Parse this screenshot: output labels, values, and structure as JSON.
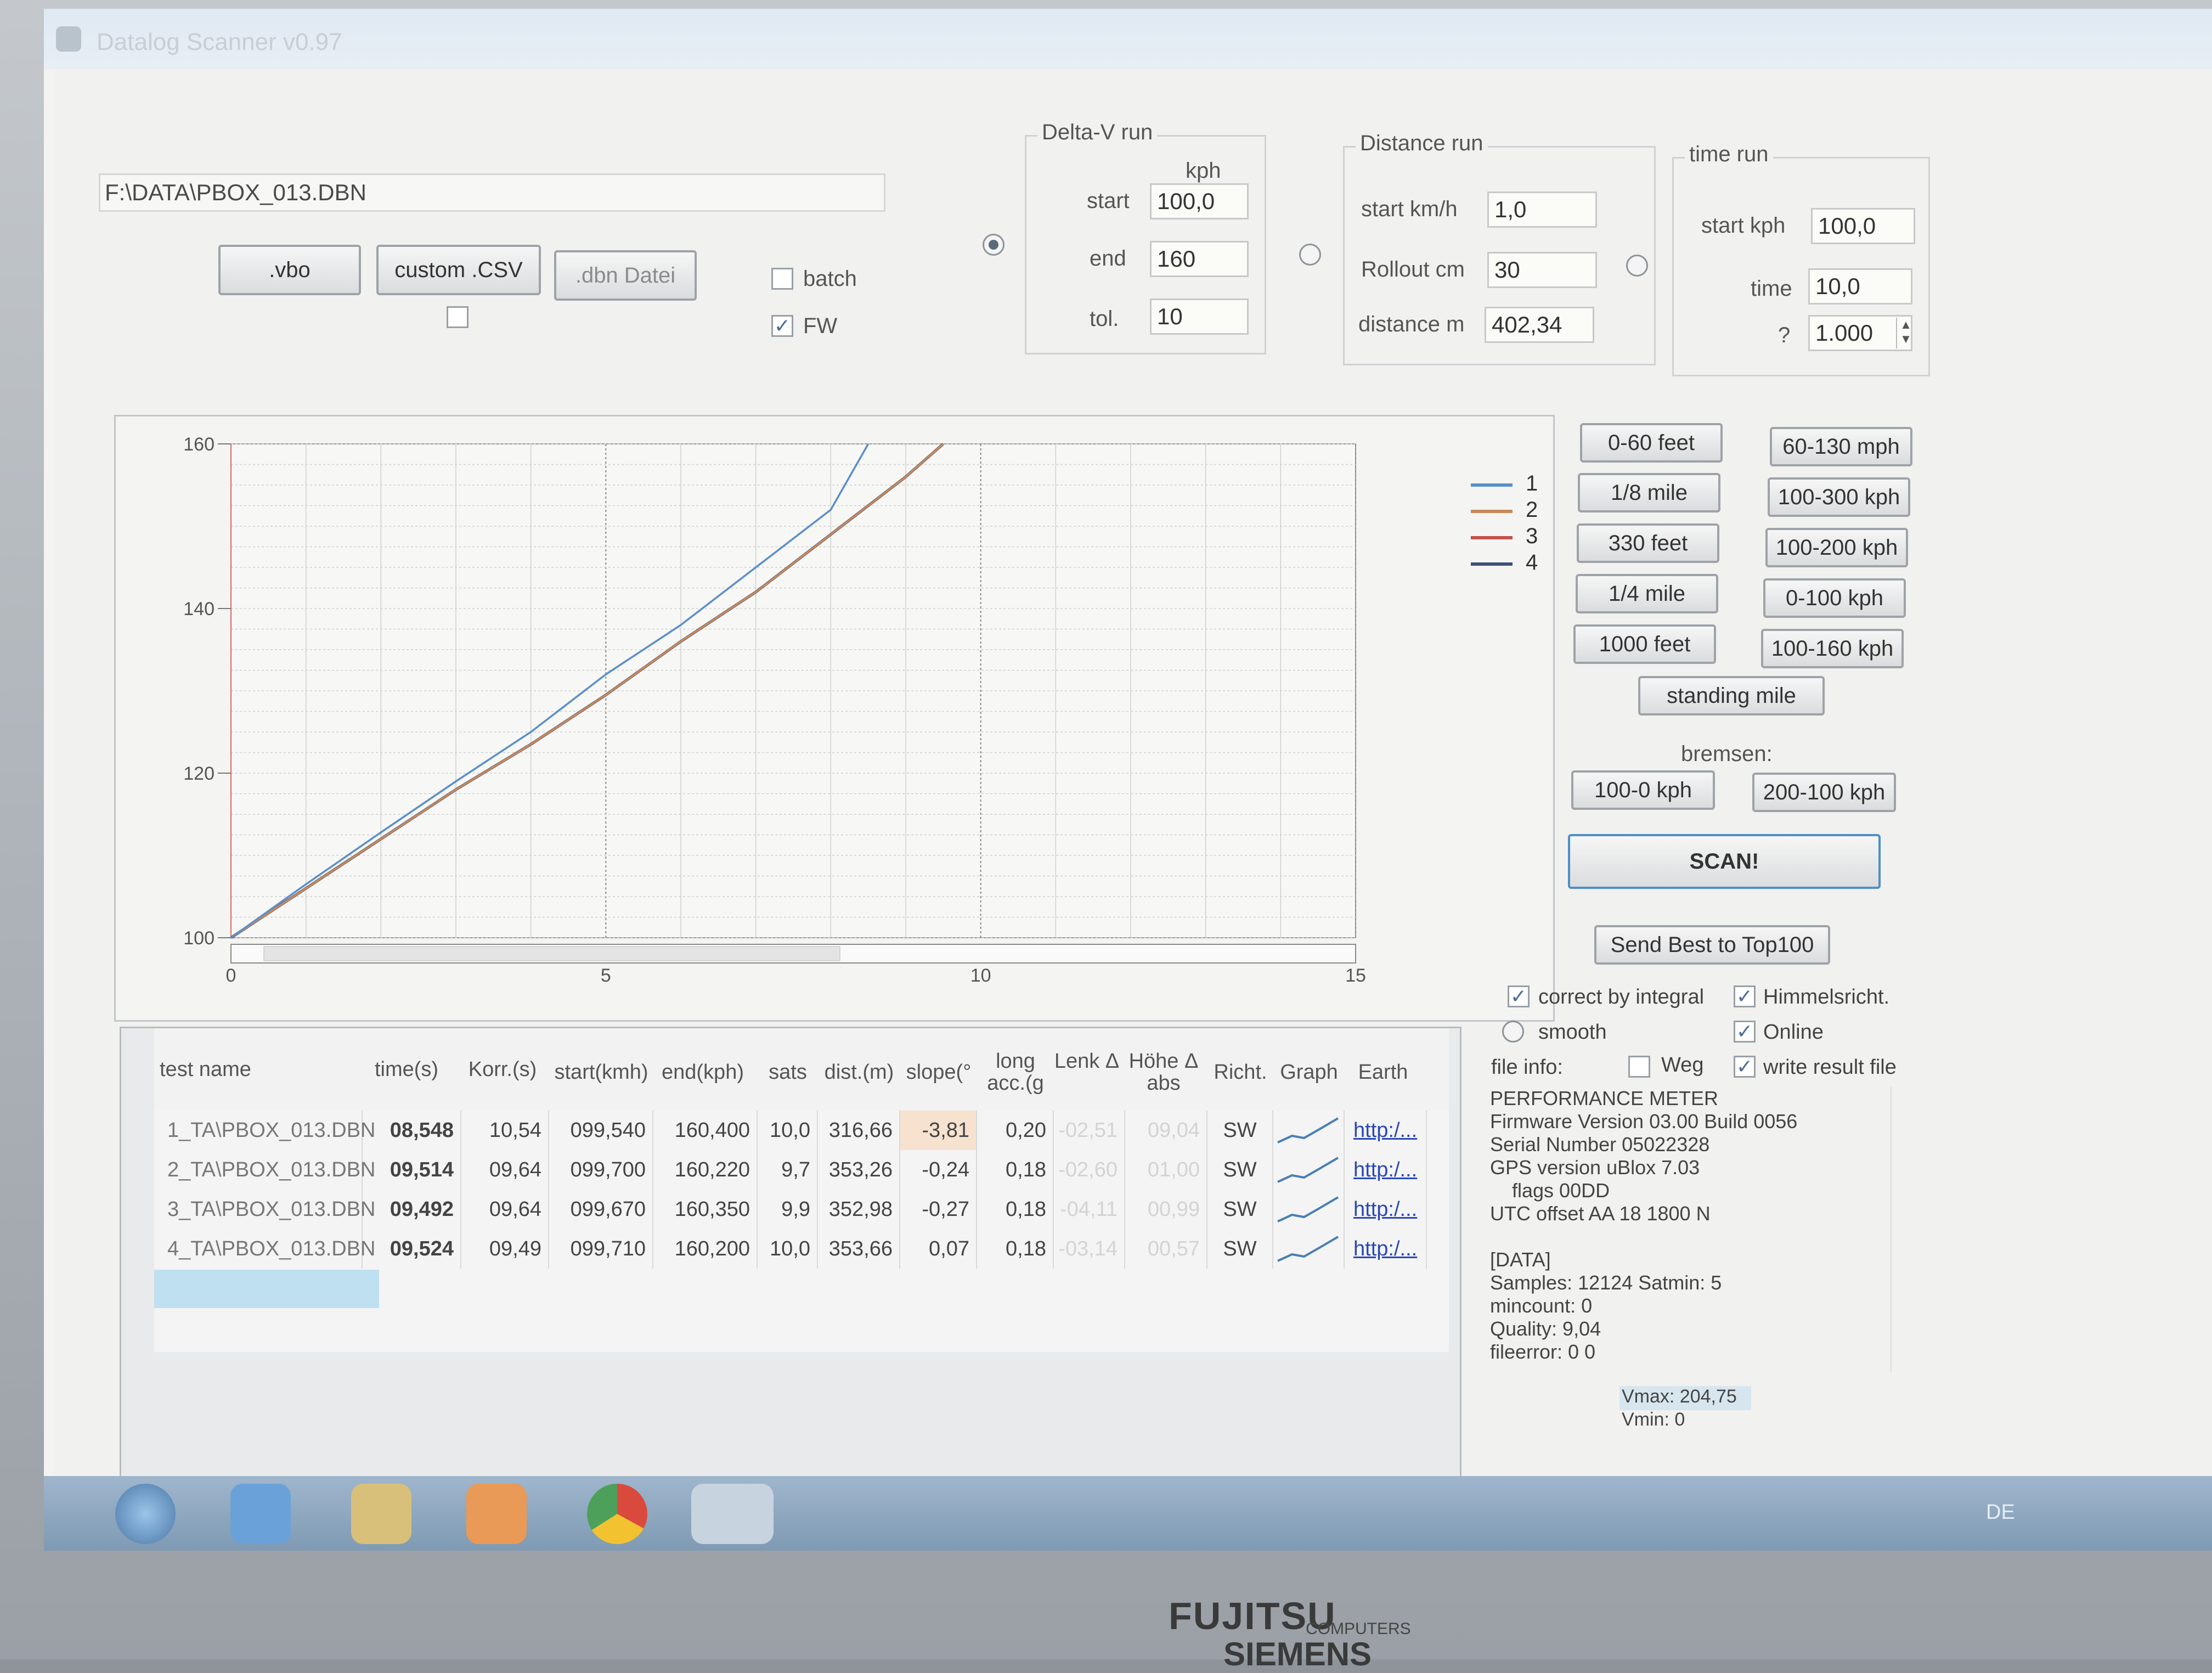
{
  "window": {
    "title": "Datalog Scanner v0.97"
  },
  "file": {
    "path": "F:\\DATA\\PBOX_013.DBN"
  },
  "buttons": {
    "vbo": ".vbo",
    "csv": "custom .CSV",
    "dbn": ".dbn Datei"
  },
  "options": {
    "batch": "batch",
    "fw": "FW"
  },
  "delta_v": {
    "title": "Delta-V run",
    "unit": "kph",
    "start_label": "start",
    "start": "100,0",
    "end_label": "end",
    "end": "160",
    "tol_label": "tol.",
    "tol": "10"
  },
  "distance_run": {
    "title": "Distance run",
    "start_label": "start km/h",
    "start": "1,0",
    "rollout_label": "Rollout cm",
    "rollout": "30",
    "distance_label": "distance m",
    "distance": "402,34"
  },
  "time_run": {
    "title": "time run",
    "start_label": "start kph",
    "start": "100,0",
    "time_label": "time",
    "time": "10,0",
    "q_label": "?",
    "q_value": "1.000"
  },
  "chart_data": {
    "type": "line",
    "title": "",
    "xlabel": "",
    "ylabel": "",
    "xlim": [
      0,
      15
    ],
    "ylim": [
      100,
      160
    ],
    "x_ticks": [
      "0",
      "5",
      "10",
      "15"
    ],
    "y_ticks": [
      "100",
      "120",
      "140",
      "160"
    ],
    "legend": [
      "1",
      "2",
      "3",
      "4"
    ],
    "legend_position": "top-right",
    "grid": true,
    "colors": [
      "#5b8fc9",
      "#c98a58",
      "#c4504a",
      "#3e4f7a"
    ],
    "series": [
      {
        "name": "1",
        "x": [
          0,
          1,
          2,
          3,
          4,
          5,
          6,
          7,
          8,
          8.5
        ],
        "y": [
          100,
          106.5,
          112.8,
          119,
          125,
          132,
          138,
          145,
          152,
          160
        ]
      },
      {
        "name": "2",
        "x": [
          0,
          1,
          2,
          3,
          4,
          5,
          6,
          7,
          8,
          9,
          9.5
        ],
        "y": [
          100,
          106,
          112,
          118,
          123.5,
          129.5,
          136,
          142,
          149,
          156,
          160
        ]
      },
      {
        "name": "3",
        "x": [
          0,
          1,
          2,
          3,
          4,
          5,
          6,
          7,
          8,
          9,
          9.5
        ],
        "y": [
          100,
          106,
          112,
          118,
          123.5,
          129.5,
          136,
          142,
          149,
          156,
          160
        ]
      },
      {
        "name": "4",
        "x": [
          0,
          1,
          2,
          3,
          4,
          5,
          6,
          7,
          8,
          9,
          9.5
        ],
        "y": [
          100,
          106,
          112,
          118,
          123.5,
          129.5,
          136,
          142,
          149,
          156,
          160
        ]
      }
    ]
  },
  "presets": {
    "left": [
      "0-60 feet",
      "1/8 mile",
      "330 feet",
      "1/4 mile",
      "1000 feet"
    ],
    "right": [
      "60-130 mph",
      "100-300 kph",
      "100-200 kph",
      "0-100 kph",
      "100-160 kph"
    ],
    "standing": "standing mile",
    "bremsen_label": "bremsen:",
    "brakes": [
      "100-0 kph",
      "200-100 kph"
    ],
    "scan": "SCAN!",
    "send": "Send Best to Top100"
  },
  "table": {
    "headers": [
      "test name",
      "time(s)",
      "Korr.(s)",
      "start(kmh)",
      "end(kph)",
      "sats",
      "dist.(m)",
      "slope(°",
      "long acc.(g",
      "Lenk Δ",
      "Höhe Δ abs",
      "Richt.",
      "Graph",
      "Earth"
    ],
    "rows": [
      [
        "1_TA\\PBOX_013.DBN",
        "08,548",
        "10,54",
        "099,540",
        "160,400",
        "10,0",
        "316,66",
        "-3,81",
        "0,20",
        "-02,51",
        "09,04",
        "SW",
        "",
        "http:/..."
      ],
      [
        "2_TA\\PBOX_013.DBN",
        "09,514",
        "09,64",
        "099,700",
        "160,220",
        "9,7",
        "353,26",
        "-0,24",
        "0,18",
        "-02,60",
        "01,00",
        "SW",
        "",
        "http:/..."
      ],
      [
        "3_TA\\PBOX_013.DBN",
        "09,492",
        "09,64",
        "099,670",
        "160,350",
        "9,9",
        "352,98",
        "-0,27",
        "0,18",
        "-04,11",
        "00,99",
        "SW",
        "",
        "http:/..."
      ],
      [
        "4_TA\\PBOX_013.DBN",
        "09,524",
        "09,49",
        "099,710",
        "160,200",
        "10,0",
        "353,66",
        "0,07",
        "0,18",
        "-03,14",
        "00,57",
        "SW",
        "",
        "http:/..."
      ]
    ]
  },
  "settings": {
    "correct": "correct by integral",
    "himmel": "Himmelsricht.",
    "smooth": "smooth",
    "online": "Online",
    "fileinfo": "file info:",
    "weg": "Weg",
    "write": "write result file"
  },
  "info_lines": [
    "PERFORMANCE METER",
    "Firmware Version 03.00 Build 0056",
    "Serial Number 05022328",
    "GPS version uBlox 7.03",
    "flags 00DD",
    "UTC offset AA 18 1800 N",
    "",
    "[DATA]",
    "Samples: 12124   Satmin: 5",
    "mincount: 0",
    "Quality: 9,04",
    "fileerror: 0 0"
  ],
  "vstats": {
    "vmax": "Vmax: 204,75",
    "vmin": "Vmin: 0"
  },
  "taskbar": {
    "lang": "DE"
  },
  "laptop": {
    "brand": "FUJITSU",
    "sub": "COMPUTERS",
    "brand2": "SIEMENS"
  }
}
